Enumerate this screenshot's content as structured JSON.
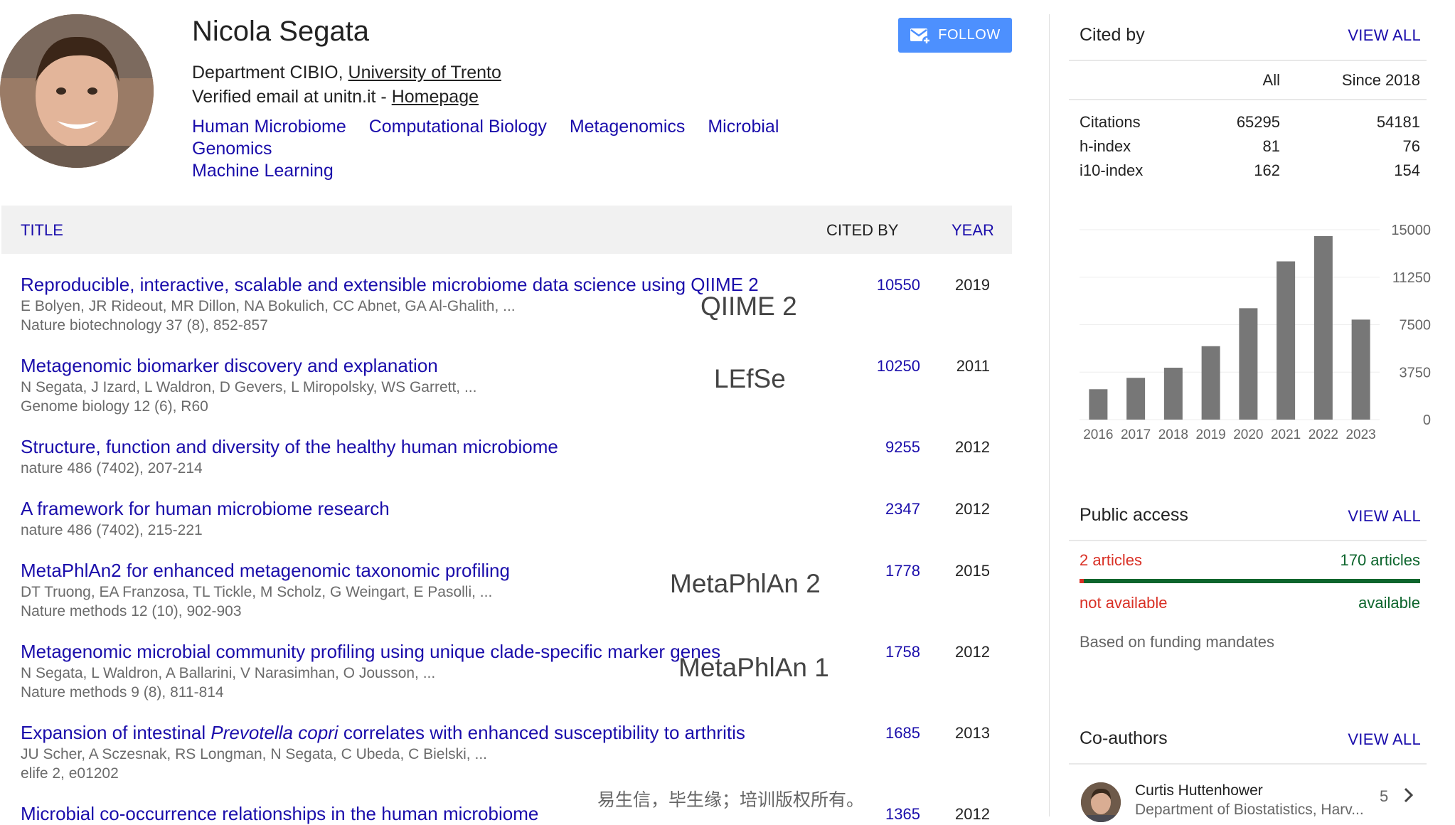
{
  "profile": {
    "name": "Nicola Segata",
    "affiliation_prefix": "Department CIBIO, ",
    "affiliation_link": "University of Trento",
    "email_prefix": "Verified email at unitn.it - ",
    "homepage_link": "Homepage",
    "interests": [
      "Human Microbiome",
      "Computational Biology",
      "Metagenomics",
      "Microbial Genomics",
      "Machine Learning"
    ],
    "follow_label": "FOLLOW"
  },
  "table": {
    "headers": {
      "title": "TITLE",
      "cited_by": "CITED BY",
      "year": "YEAR"
    },
    "rows": [
      {
        "title": "Reproducible, interactive, scalable and extensible microbiome data science using QIIME 2",
        "authors": "E Bolyen, JR Rideout, MR Dillon, NA Bokulich, CC Abnet, GA Al-Ghalith, ...",
        "venue": "Nature biotechnology 37 (8), 852-857",
        "cited_by": "10550",
        "year": "2019"
      },
      {
        "title": "Metagenomic biomarker discovery and explanation",
        "authors": "N Segata, J Izard, L Waldron, D Gevers, L Miropolsky, WS Garrett, ...",
        "venue": "Genome biology 12 (6), R60",
        "cited_by": "10250",
        "year": "2011"
      },
      {
        "title": "Structure, function and diversity of the healthy human microbiome",
        "authors": "",
        "venue": "nature 486 (7402), 207-214",
        "cited_by": "9255",
        "year": "2012"
      },
      {
        "title": "A framework for human microbiome research",
        "authors": "",
        "venue": "nature 486 (7402), 215-221",
        "cited_by": "2347",
        "year": "2012"
      },
      {
        "title": "MetaPhlAn2 for enhanced metagenomic taxonomic profiling",
        "authors": "DT Truong, EA Franzosa, TL Tickle, M Scholz, G Weingart, E Pasolli, ...",
        "venue": "Nature methods 12 (10), 902-903",
        "cited_by": "1778",
        "year": "2015"
      },
      {
        "title": "Metagenomic microbial community profiling using unique clade-specific marker genes",
        "authors": "N Segata, L Waldron, A Ballarini, V Narasimhan, O Jousson, ...",
        "venue": "Nature methods 9 (8), 811-814",
        "cited_by": "1758",
        "year": "2012"
      },
      {
        "title_pre": "Expansion of intestinal ",
        "title_em": "Prevotella copri",
        "title_post": " correlates with enhanced susceptibility to arthritis",
        "authors": "JU Scher, A Sczesnak, RS Longman, N Segata, C Ubeda, C Bielski, ...",
        "venue": "elife 2, e01202",
        "cited_by": "1685",
        "year": "2013"
      },
      {
        "title": "Microbial co-occurrence relationships in the human microbiome",
        "authors": "",
        "venue": "",
        "cited_by": "1365",
        "year": "2012"
      }
    ]
  },
  "overlays": {
    "qiime2": "QIIME 2",
    "lefse": "LEfSe",
    "metaphlan2": "MetaPhlAn 2",
    "metaphlan1": "MetaPhlAn 1",
    "watermark": "易生信，毕生缘；培训版权所有。"
  },
  "cited_by": {
    "heading": "Cited by",
    "view_all": "VIEW ALL",
    "col_all": "All",
    "col_since": "Since 2018",
    "rows": [
      {
        "label": "Citations",
        "all": "65295",
        "since": "54181"
      },
      {
        "label": "h-index",
        "all": "81",
        "since": "76"
      },
      {
        "label": "i10-index",
        "all": "162",
        "since": "154"
      }
    ]
  },
  "chart_data": {
    "type": "bar",
    "categories": [
      "2016",
      "2017",
      "2018",
      "2019",
      "2020",
      "2021",
      "2022",
      "2023"
    ],
    "values": [
      2400,
      3300,
      4100,
      5800,
      8800,
      12500,
      14500,
      7900
    ],
    "ylim": [
      0,
      15000
    ],
    "yticks": [
      "0",
      "3750",
      "7500",
      "11250",
      "15000"
    ],
    "ytick_values": [
      0,
      3750,
      7500,
      11250,
      15000
    ],
    "bar_color": "#777777",
    "y_axis_side": "right"
  },
  "public_access": {
    "heading": "Public access",
    "view_all": "VIEW ALL",
    "not_available_count": "2 articles",
    "available_count": "170 articles",
    "not_available_label": "not available",
    "available_label": "available",
    "available_fraction": 0.988,
    "note": "Based on funding mandates",
    "red": "#d93025",
    "green": "#0d652d"
  },
  "coauthors": {
    "heading": "Co-authors",
    "view_all": "VIEW ALL",
    "items": [
      {
        "name": "Curtis Huttenhower",
        "affiliation": "Department of Biostatistics, Harv...",
        "count": "5"
      }
    ]
  }
}
